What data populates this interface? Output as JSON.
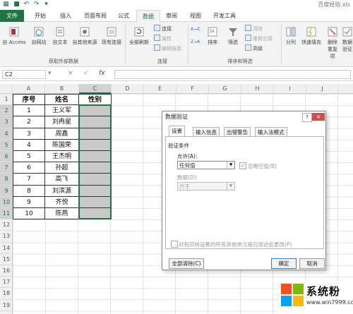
{
  "window": {
    "title": "百度经验.xls"
  },
  "tabs": [
    "文件",
    "开始",
    "插入",
    "页面布局",
    "公式",
    "数据",
    "审阅",
    "视图",
    "开发工具"
  ],
  "ribbon": {
    "get_external": {
      "buttons": [
        "自 Access",
        "自网站",
        "自文本",
        "自其他来源",
        "现有连接"
      ],
      "label": "获取外部数据"
    },
    "connections": {
      "refresh": "全部刷新",
      "items": [
        "连接",
        "属性",
        "编辑链接"
      ],
      "label": "连接"
    },
    "sort_filter": {
      "sort_asc": "A→Z",
      "sort_desc": "Z→A",
      "sort": "排序",
      "filter": "筛选",
      "items": [
        "清除",
        "重新应用",
        "高级"
      ],
      "label": "排序和筛选"
    },
    "tools": {
      "buttons": [
        "分列",
        "快速填充",
        "删除重复项",
        "数据验证"
      ]
    }
  },
  "formula_bar": {
    "name_box": "C2",
    "fx": "fx",
    "cancel": "×",
    "enter": "✓",
    "value": ""
  },
  "columns": [
    "A",
    "B",
    "C",
    "D",
    "E",
    "F",
    "G",
    "H",
    "I",
    "J"
  ],
  "rows": [
    "1",
    "2",
    "3",
    "4",
    "5",
    "6",
    "7",
    "8",
    "9",
    "10",
    "11",
    "12",
    "13",
    "14",
    "15",
    "16",
    "17",
    "18",
    "19"
  ],
  "table": {
    "headers": [
      "序号",
      "姓名",
      "性别"
    ],
    "rows": [
      [
        "1",
        "王义军"
      ],
      [
        "2",
        "刘冉星"
      ],
      [
        "3",
        "周鑫"
      ],
      [
        "4",
        "陈国荣"
      ],
      [
        "5",
        "王杰明"
      ],
      [
        "6",
        "孙超"
      ],
      [
        "7",
        "高飞"
      ],
      [
        "8",
        "刘滨源"
      ],
      [
        "9",
        "齐悦"
      ],
      [
        "10",
        "陈燕"
      ]
    ]
  },
  "dialog": {
    "title": "数据验证",
    "help": "?",
    "close": "×",
    "tabs": [
      "设置",
      "输入信息",
      "出错警告",
      "输入法模式"
    ],
    "section": "验证条件",
    "allow_label": "允许(A):",
    "allow_value": "任何值",
    "ignore_blank": "忽略空值(B)",
    "data_label": "数据(D):",
    "data_value": "介于",
    "apply_all": "对有同样设置的所有其他单元格应用这些更改(P)",
    "clear_all": "全部清除(C)",
    "ok": "确定",
    "cancel": "取消"
  },
  "watermark": {
    "name": "系统粉",
    "url": "www.win7999.com"
  },
  "colors": {
    "excel_green": "#217346",
    "selection_fill": "#c9c9c9",
    "close_red": "#c75050"
  }
}
